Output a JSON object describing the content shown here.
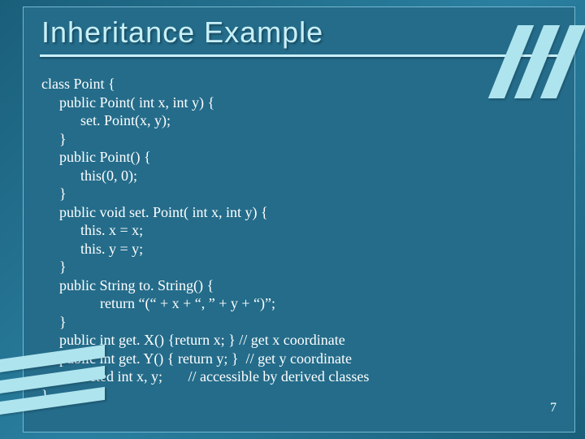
{
  "title": "Inheritance Example",
  "page_number": "7",
  "code": {
    "l0": "class Point {",
    "l1": "public Point( int x, int y) {",
    "l2": "set. Point(x, y);",
    "l3": "}",
    "l4": "public Point() {",
    "l5": "this(0, 0);",
    "l6": "}",
    "l7": "public void set. Point( int x, int y) {",
    "l8": "this. x = x;",
    "l9": "this. y = y;",
    "l10": "}",
    "l11": "public String to. String() {",
    "l12": "return “(“ + x + “, ” + y + “)”;",
    "l13": "}",
    "l14": "public int get. X() {return x; } // get x coordinate",
    "l15": "public int get. Y() { return y; }  // get y coordinate",
    "l16": "protected int x, y;       // accessible by derived classes",
    "l17": "}"
  }
}
